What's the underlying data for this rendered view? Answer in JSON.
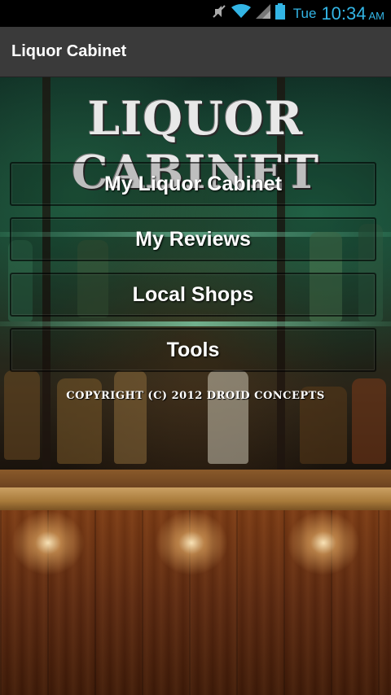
{
  "status_bar": {
    "day": "Tue",
    "time": "10:34",
    "ampm": "AM",
    "icons": [
      "mute-icon",
      "wifi-icon",
      "signal-icon",
      "battery-icon"
    ],
    "accent_color": "#33b5e5"
  },
  "action_bar": {
    "title": "Liquor Cabinet"
  },
  "main": {
    "logo_text": "LIQUOR CABINET",
    "menu": [
      {
        "label": "My Liquor Cabinet"
      },
      {
        "label": "My Reviews"
      },
      {
        "label": "Local Shops"
      },
      {
        "label": "Tools"
      }
    ],
    "copyright": "COPYRIGHT (C) 2012 DROID CONCEPTS"
  }
}
